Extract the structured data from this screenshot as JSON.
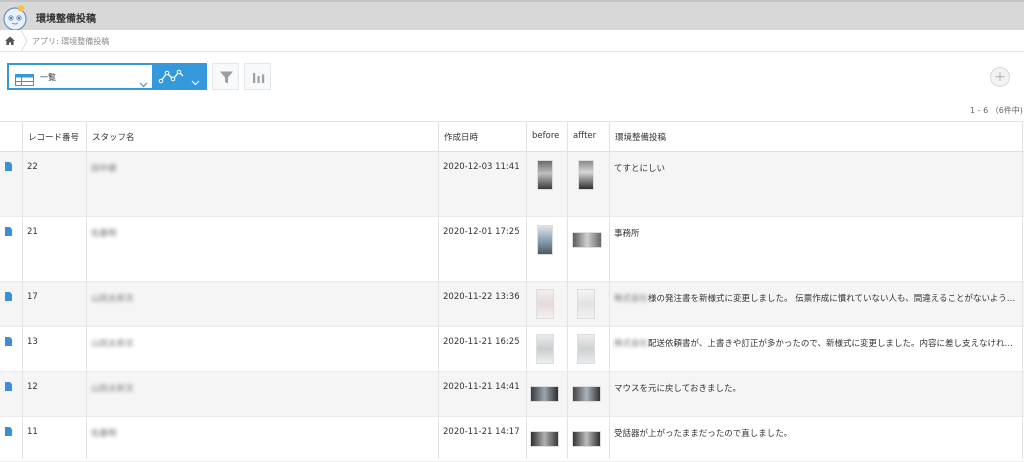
{
  "app": {
    "title": "環境整備投稿"
  },
  "breadcrumb": {
    "text": "アプリ: 環境整備投稿"
  },
  "toolbar": {
    "view_label": "一覧",
    "graph_icon": "graph-icon",
    "filter_icon": "funnel-icon",
    "chart_icon": "bar-chart-icon",
    "add_icon": "plus-icon"
  },
  "paging": {
    "text": "1 - 6 （6件中)"
  },
  "table": {
    "headers": [
      "レコード番号",
      "スタッフ名",
      "作成日時",
      "before",
      "affter",
      "環境整備投稿"
    ],
    "rows": [
      {
        "id": "22",
        "staff": "田中健",
        "date": "2020-12-03 11:41",
        "prefix": "",
        "post": "てすとにしい"
      },
      {
        "id": "21",
        "staff": "佐藤明",
        "date": "2020-12-01 17:25",
        "prefix": "",
        "post": "事務所"
      },
      {
        "id": "17",
        "staff": "山田太郎次",
        "date": "2020-11-22 13:36",
        "prefix": "株式会社",
        "post": "様の発注書を新様式に変更しました。 伝票作成に慣れていない人も、間違えることがないよう…"
      },
      {
        "id": "13",
        "staff": "山田太郎次",
        "date": "2020-11-21 16:25",
        "prefix": "株式会社",
        "post": "配送依頼書が、上書きや訂正が多かったので、新様式に変更しました。内容に差し支えなければ…"
      },
      {
        "id": "12",
        "staff": "山田太郎次",
        "date": "2020-11-21 14:41",
        "prefix": "",
        "post": "マウスを元に戻しておきました。"
      },
      {
        "id": "11",
        "staff": "佐藤明",
        "date": "2020-11-21 14:17",
        "prefix": "",
        "post": "受話器が上がったままだったので直しました。"
      }
    ]
  },
  "colors": {
    "accent": "#3498db",
    "topbar": "#d8d8d8",
    "row_alt": "#f5f5f5"
  }
}
